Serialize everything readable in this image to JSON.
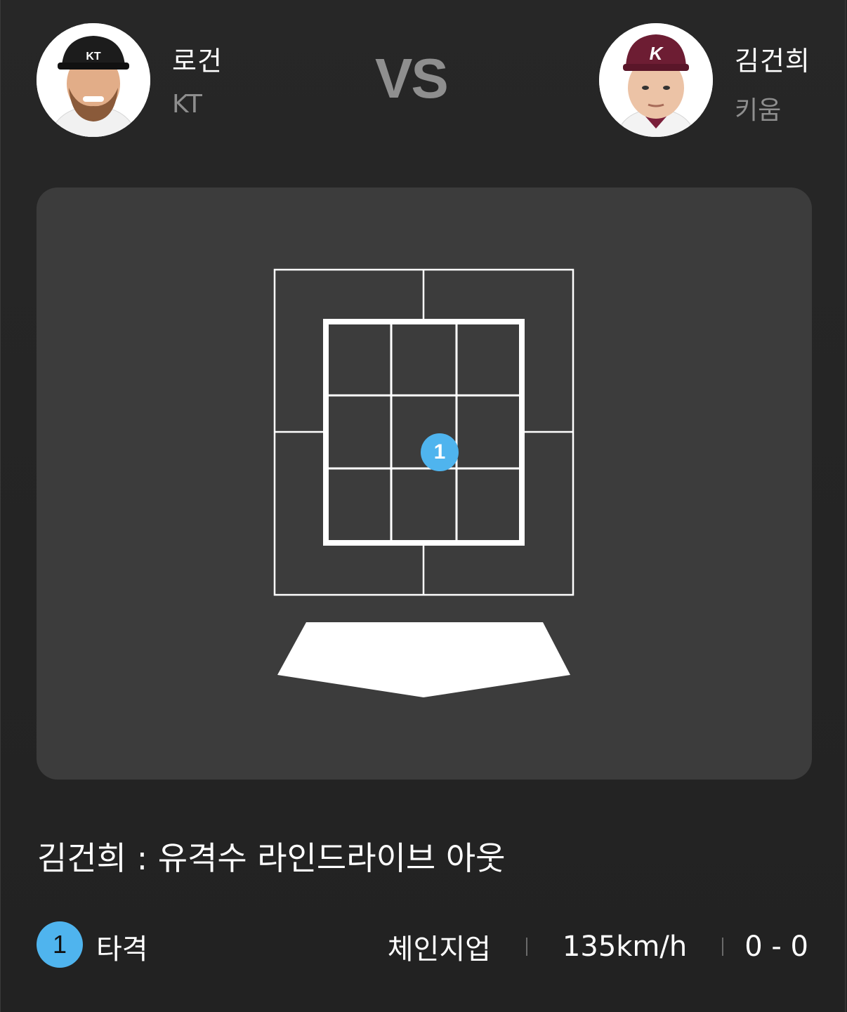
{
  "matchup": {
    "vs_label": "VS",
    "batter": {
      "name": "로건",
      "team": "KT"
    },
    "pitcher": {
      "name": "김건희",
      "team": "키움"
    }
  },
  "strike_zone": {
    "pitches": [
      {
        "number": "1",
        "color": "#4fb4ee"
      }
    ]
  },
  "result": {
    "description": "김건희 : 유격수 라인드라이브 아웃"
  },
  "pitch_detail": {
    "number": "1",
    "type_label": "타격",
    "pitch_type": "체인지업",
    "speed": "135km/h",
    "count": "0 - 0"
  },
  "colors": {
    "background": "#262626",
    "panel": "#3c3c3c",
    "accent": "#4fb4ee",
    "muted_text": "#8e8e8e"
  }
}
